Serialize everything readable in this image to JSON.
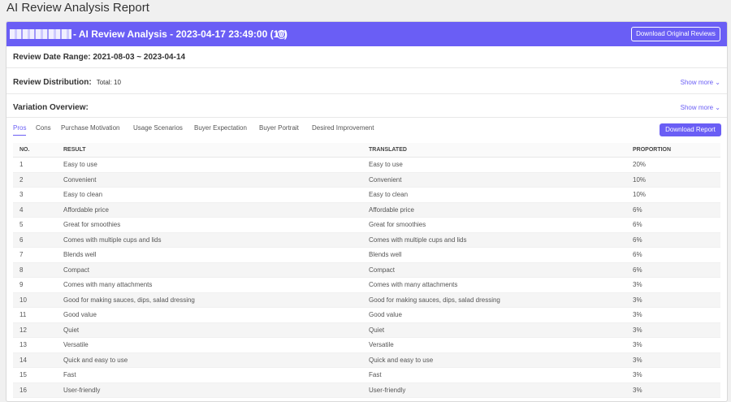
{
  "page": {
    "title": "AI Review Analysis Report"
  },
  "banner": {
    "title": "- AI Review Analysis - 2023-04-17 23:49:00  (10)",
    "info_icon": "info-icon",
    "download_original": "Download Original Reviews"
  },
  "review_range": {
    "label": "Review Date Range: 2021-08-03 ~ 2023-04-14"
  },
  "distribution": {
    "label": "Review Distribution:",
    "total": "Total: 10",
    "show_more": "Show more ⌄"
  },
  "variation": {
    "label": "Variation Overview:",
    "show_more": "Show more ⌄"
  },
  "tabs": [
    "Pros",
    "Cons",
    "Purchase Motivation",
    "Usage Scenarios",
    "Buyer Expectation",
    "Buyer Portrait",
    "Desired Improvement"
  ],
  "download_report": "Download Report",
  "table": {
    "headers": [
      "NO.",
      "RESULT",
      "TRANSLATED",
      "PROPORTION"
    ],
    "rows": [
      [
        "1",
        "Easy to use",
        "Easy to use",
        "20%"
      ],
      [
        "2",
        "Convenient",
        "Convenient",
        "10%"
      ],
      [
        "3",
        "Easy to clean",
        "Easy to clean",
        "10%"
      ],
      [
        "4",
        "Affordable price",
        "Affordable price",
        "6%"
      ],
      [
        "5",
        "Great for smoothies",
        "Great for smoothies",
        "6%"
      ],
      [
        "6",
        "Comes with multiple cups and lids",
        "Comes with multiple cups and lids",
        "6%"
      ],
      [
        "7",
        "Blends well",
        "Blends well",
        "6%"
      ],
      [
        "8",
        "Compact",
        "Compact",
        "6%"
      ],
      [
        "9",
        "Comes with many attachments",
        "Comes with many attachments",
        "3%"
      ],
      [
        "10",
        "Good for making sauces, dips, salad dressing",
        "Good for making sauces, dips, salad dressing",
        "3%"
      ],
      [
        "11",
        "Good value",
        "Good value",
        "3%"
      ],
      [
        "12",
        "Quiet",
        "Quiet",
        "3%"
      ],
      [
        "13",
        "Versatile",
        "Versatile",
        "3%"
      ],
      [
        "14",
        "Quick and easy to use",
        "Quick and easy to use",
        "3%"
      ],
      [
        "15",
        "Fast",
        "Fast",
        "3%"
      ],
      [
        "16",
        "User-friendly",
        "User-friendly",
        "3%"
      ]
    ]
  },
  "colors": {
    "accent": "#6a5ef5"
  }
}
